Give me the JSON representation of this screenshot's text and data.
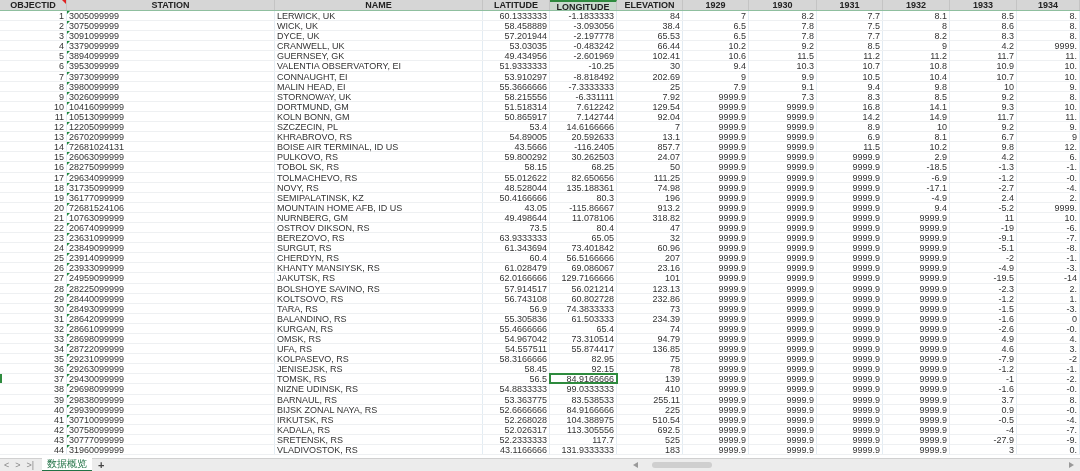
{
  "table": {
    "columns": [
      {
        "label": "OBJECTID",
        "selected": false,
        "comment": true,
        "flagged": false
      },
      {
        "label": "STATION",
        "selected": false,
        "comment": false,
        "flagged": true
      },
      {
        "label": "NAME",
        "selected": false,
        "comment": false,
        "flagged": false
      },
      {
        "label": "LATITUDE",
        "selected": false,
        "comment": false,
        "flagged": false
      },
      {
        "label": "LONGITUDE",
        "selected": true,
        "comment": false,
        "flagged": false
      },
      {
        "label": "ELEVATION",
        "selected": false,
        "comment": false,
        "flagged": false
      },
      {
        "label": "1929",
        "selected": false,
        "comment": false,
        "flagged": false
      },
      {
        "label": "1930",
        "selected": false,
        "comment": false,
        "flagged": false
      },
      {
        "label": "1931",
        "selected": false,
        "comment": false,
        "flagged": false
      },
      {
        "label": "1932",
        "selected": false,
        "comment": false,
        "flagged": false
      },
      {
        "label": "1933",
        "selected": false,
        "comment": false,
        "flagged": false
      },
      {
        "label": "1934",
        "selected": false,
        "comment": false,
        "flagged": false
      }
    ],
    "rows": [
      {
        "selected": false,
        "cells": [
          "1",
          "3005099999",
          "LERWICK, UK",
          "60.1333333",
          "-1.1833333",
          "84",
          "7",
          "8.2",
          "7.7",
          "8.1",
          "8.5",
          "8."
        ]
      },
      {
        "selected": false,
        "cells": [
          "2",
          "3075099999",
          "WICK, UK",
          "58.458889",
          "-3.093056",
          "38.4",
          "6.5",
          "7.8",
          "7.5",
          "8",
          "8.6",
          "8."
        ]
      },
      {
        "selected": false,
        "cells": [
          "3",
          "3091099999",
          "DYCE, UK",
          "57.201944",
          "-2.197778",
          "65.53",
          "6.5",
          "7.8",
          "7.7",
          "8.2",
          "8.3",
          "8."
        ]
      },
      {
        "selected": false,
        "cells": [
          "4",
          "3379099999",
          "CRANWELL, UK",
          "53.03035",
          "-0.483242",
          "66.44",
          "10.2",
          "9.2",
          "8.5",
          "9",
          "4.2",
          "9999."
        ]
      },
      {
        "selected": false,
        "cells": [
          "5",
          "3894099999",
          "GUERNSEY, GK",
          "49.434956",
          "-2.601969",
          "102.41",
          "10.6",
          "11.5",
          "11.2",
          "11.2",
          "11.7",
          "11."
        ]
      },
      {
        "selected": false,
        "cells": [
          "6",
          "3953099999",
          "VALENTIA OBSERVATORY, EI",
          "51.9333333",
          "-10.25",
          "30",
          "9.4",
          "10.3",
          "10.7",
          "10.8",
          "10.9",
          "10."
        ]
      },
      {
        "selected": false,
        "cells": [
          "7",
          "3973099999",
          "CONNAUGHT, EI",
          "53.910297",
          "-8.818492",
          "202.69",
          "9",
          "9.9",
          "10.5",
          "10.4",
          "10.7",
          "10."
        ]
      },
      {
        "selected": false,
        "cells": [
          "8",
          "3980099999",
          "MALIN HEAD, EI",
          "55.3666666",
          "-7.3333333",
          "25",
          "7.9",
          "9.1",
          "9.4",
          "9.8",
          "10",
          "9."
        ]
      },
      {
        "selected": false,
        "cells": [
          "9",
          "3026099999",
          "STORNOWAY, UK",
          "58.215556",
          "-6.331111",
          "7.92",
          "9999.9",
          "7.3",
          "8.3",
          "8.5",
          "9.2",
          "8."
        ]
      },
      {
        "selected": false,
        "cells": [
          "10",
          "10416099999",
          "DORTMUND, GM",
          "51.518314",
          "7.612242",
          "129.54",
          "9999.9",
          "9999.9",
          "16.8",
          "14.1",
          "9.3",
          "10."
        ]
      },
      {
        "selected": false,
        "cells": [
          "11",
          "10513099999",
          "KOLN BONN, GM",
          "50.865917",
          "7.142744",
          "92.04",
          "9999.9",
          "9999.9",
          "14.2",
          "14.9",
          "11.7",
          "11."
        ]
      },
      {
        "selected": false,
        "cells": [
          "12",
          "12205099999",
          "SZCZECIN, PL",
          "53.4",
          "14.6166666",
          "7",
          "9999.9",
          "9999.9",
          "8.9",
          "10",
          "9.2",
          "9."
        ]
      },
      {
        "selected": false,
        "cells": [
          "13",
          "26702099999",
          "KHRABROVO, RS",
          "54.89005",
          "20.592633",
          "13.1",
          "9999.9",
          "9999.9",
          "6.9",
          "8.1",
          "6.7",
          "9"
        ]
      },
      {
        "selected": false,
        "cells": [
          "14",
          "72681024131",
          "BOISE AIR TERMINAL, ID US",
          "43.5666",
          "-116.2405",
          "857.7",
          "9999.9",
          "9999.9",
          "11.5",
          "10.2",
          "9.8",
          "12."
        ]
      },
      {
        "selected": false,
        "cells": [
          "15",
          "26063099999",
          "PULKOVO, RS",
          "59.800292",
          "30.262503",
          "24.07",
          "9999.9",
          "9999.9",
          "9999.9",
          "2.9",
          "4.2",
          "6."
        ]
      },
      {
        "selected": false,
        "cells": [
          "16",
          "28275099999",
          "TOBOL SK, RS",
          "58.15",
          "68.25",
          "50",
          "9999.9",
          "9999.9",
          "9999.9",
          "-18.5",
          "-1.3",
          "-1."
        ]
      },
      {
        "selected": false,
        "cells": [
          "17",
          "29634099999",
          "TOLMACHEVO, RS",
          "55.012622",
          "82.650656",
          "111.25",
          "9999.9",
          "9999.9",
          "9999.9",
          "-6.9",
          "-1.2",
          "-0."
        ]
      },
      {
        "selected": false,
        "cells": [
          "18",
          "31735099999",
          "NOVY, RS",
          "48.528044",
          "135.188361",
          "74.98",
          "9999.9",
          "9999.9",
          "9999.9",
          "-17.1",
          "-2.7",
          "-4."
        ]
      },
      {
        "selected": false,
        "cells": [
          "19",
          "36177099999",
          "SEMIPALATINSK, KZ",
          "50.4166666",
          "80.3",
          "196",
          "9999.9",
          "9999.9",
          "9999.9",
          "-4.9",
          "2.4",
          "2."
        ]
      },
      {
        "selected": false,
        "cells": [
          "20",
          "72681524106",
          "MOUNTAIN HOME AFB, ID US",
          "43.05",
          "-115.86667",
          "913.2",
          "9999.9",
          "9999.9",
          "9999.9",
          "9.4",
          "-5.2",
          "9999."
        ]
      },
      {
        "selected": false,
        "cells": [
          "21",
          "10763099999",
          "NURNBERG, GM",
          "49.498644",
          "11.078106",
          "318.82",
          "9999.9",
          "9999.9",
          "9999.9",
          "9999.9",
          "11",
          "10."
        ]
      },
      {
        "selected": false,
        "cells": [
          "22",
          "20674099999",
          "OSTROV DIKSON, RS",
          "73.5",
          "80.4",
          "47",
          "9999.9",
          "9999.9",
          "9999.9",
          "9999.9",
          "-19",
          "-6."
        ]
      },
      {
        "selected": false,
        "cells": [
          "23",
          "23631099999",
          "BEREZOVO, RS",
          "63.9333333",
          "65.05",
          "32",
          "9999.9",
          "9999.9",
          "9999.9",
          "9999.9",
          "-9.1",
          "-7."
        ]
      },
      {
        "selected": false,
        "cells": [
          "24",
          "23849099999",
          "SURGUT, RS",
          "61.343694",
          "73.401842",
          "60.96",
          "9999.9",
          "9999.9",
          "9999.9",
          "9999.9",
          "-5.1",
          "-8."
        ]
      },
      {
        "selected": false,
        "cells": [
          "25",
          "23914099999",
          "CHERDYN, RS",
          "60.4",
          "56.5166666",
          "207",
          "9999.9",
          "9999.9",
          "9999.9",
          "9999.9",
          "-2",
          "-1."
        ]
      },
      {
        "selected": false,
        "cells": [
          "26",
          "23933099999",
          "KHANTY MANSIYSK, RS",
          "61.028479",
          "69.086067",
          "23.16",
          "9999.9",
          "9999.9",
          "9999.9",
          "9999.9",
          "-4.9",
          "-3."
        ]
      },
      {
        "selected": false,
        "cells": [
          "27",
          "24959099999",
          "JAKUTSK, RS",
          "62.0166666",
          "129.7166666",
          "101",
          "9999.9",
          "9999.9",
          "9999.9",
          "9999.9",
          "-19.5",
          "-14"
        ]
      },
      {
        "selected": false,
        "cells": [
          "28",
          "28225099999",
          "BOLSHOYE SAVINO, RS",
          "57.914517",
          "56.021214",
          "123.13",
          "9999.9",
          "9999.9",
          "9999.9",
          "9999.9",
          "-2.3",
          "2."
        ]
      },
      {
        "selected": false,
        "cells": [
          "29",
          "28440099999",
          "KOLTSOVO, RS",
          "56.743108",
          "60.802728",
          "232.86",
          "9999.9",
          "9999.9",
          "9999.9",
          "9999.9",
          "-1.2",
          "1."
        ]
      },
      {
        "selected": false,
        "cells": [
          "30",
          "28493099999",
          "TARA, RS",
          "56.9",
          "74.3833333",
          "73",
          "9999.9",
          "9999.9",
          "9999.9",
          "9999.9",
          "-1.5",
          "-3."
        ]
      },
      {
        "selected": false,
        "cells": [
          "31",
          "28642099999",
          "BALANDINO, RS",
          "55.305836",
          "61.503333",
          "234.39",
          "9999.9",
          "9999.9",
          "9999.9",
          "9999.9",
          "-1.6",
          "0"
        ]
      },
      {
        "selected": false,
        "cells": [
          "32",
          "28661099999",
          "KURGAN, RS",
          "55.4666666",
          "65.4",
          "74",
          "9999.9",
          "9999.9",
          "9999.9",
          "9999.9",
          "-2.6",
          "-0."
        ]
      },
      {
        "selected": false,
        "cells": [
          "33",
          "28698099999",
          "OMSK, RS",
          "54.967042",
          "73.310514",
          "94.79",
          "9999.9",
          "9999.9",
          "9999.9",
          "9999.9",
          "4.9",
          "4."
        ]
      },
      {
        "selected": false,
        "cells": [
          "34",
          "28722099999",
          "UFA, RS",
          "54.557511",
          "55.874417",
          "136.85",
          "9999.9",
          "9999.9",
          "9999.9",
          "9999.9",
          "4.6",
          "3."
        ]
      },
      {
        "selected": false,
        "cells": [
          "35",
          "29231099999",
          "KOLPASEVO, RS",
          "58.3166666",
          "82.95",
          "75",
          "9999.9",
          "9999.9",
          "9999.9",
          "9999.9",
          "-7.9",
          "-2"
        ]
      },
      {
        "selected": false,
        "cells": [
          "36",
          "29263099999",
          "JENISEJSK, RS",
          "58.45",
          "92.15",
          "78",
          "9999.9",
          "9999.9",
          "9999.9",
          "9999.9",
          "-1.2",
          "-1."
        ]
      },
      {
        "selected": true,
        "cells": [
          "37",
          "29430099999",
          "TOMSK, RS",
          "56.5",
          "84.9166666",
          "139",
          "9999.9",
          "9999.9",
          "9999.9",
          "9999.9",
          "-1",
          "-2."
        ]
      },
      {
        "selected": false,
        "cells": [
          "38",
          "29698099999",
          "NIZNE UDINSK, RS",
          "54.8833333",
          "99.0333333",
          "410",
          "9999.9",
          "9999.9",
          "9999.9",
          "9999.9",
          "-1.6",
          "-0."
        ]
      },
      {
        "selected": false,
        "cells": [
          "39",
          "29838099999",
          "BARNAUL, RS",
          "53.363775",
          "83.538533",
          "255.11",
          "9999.9",
          "9999.9",
          "9999.9",
          "9999.9",
          "3.7",
          "8."
        ]
      },
      {
        "selected": false,
        "cells": [
          "40",
          "29939099999",
          "BIJSK ZONAL NAYA, RS",
          "52.6666666",
          "84.9166666",
          "225",
          "9999.9",
          "9999.9",
          "9999.9",
          "9999.9",
          "0.9",
          "-0."
        ]
      },
      {
        "selected": false,
        "cells": [
          "41",
          "30710099999",
          "IRKUTSK, RS",
          "52.268028",
          "104.388975",
          "510.54",
          "9999.9",
          "9999.9",
          "9999.9",
          "9999.9",
          "-0.5",
          "-4."
        ]
      },
      {
        "selected": false,
        "cells": [
          "42",
          "30758099999",
          "KADALA, RS",
          "52.026317",
          "113.305556",
          "692.5",
          "9999.9",
          "9999.9",
          "9999.9",
          "9999.9",
          "-4",
          "-7."
        ]
      },
      {
        "selected": false,
        "cells": [
          "43",
          "30777099999",
          "SRETENSK, RS",
          "52.2333333",
          "117.7",
          "525",
          "9999.9",
          "9999.9",
          "9999.9",
          "9999.9",
          "-27.9",
          "-9."
        ]
      },
      {
        "selected": false,
        "cells": [
          "44",
          "31960099999",
          "VLADIVOSTOK, RS",
          "43.1166666",
          "131.9333333",
          "183",
          "9999.9",
          "9999.9",
          "9999.9",
          "9999.9",
          "3",
          "0."
        ]
      }
    ]
  },
  "sheet_nav": [
    "<",
    ">",
    ">|"
  ],
  "sheet_tabs": [
    {
      "label": "数据概览",
      "selected": true
    }
  ],
  "add_sheet": "+"
}
